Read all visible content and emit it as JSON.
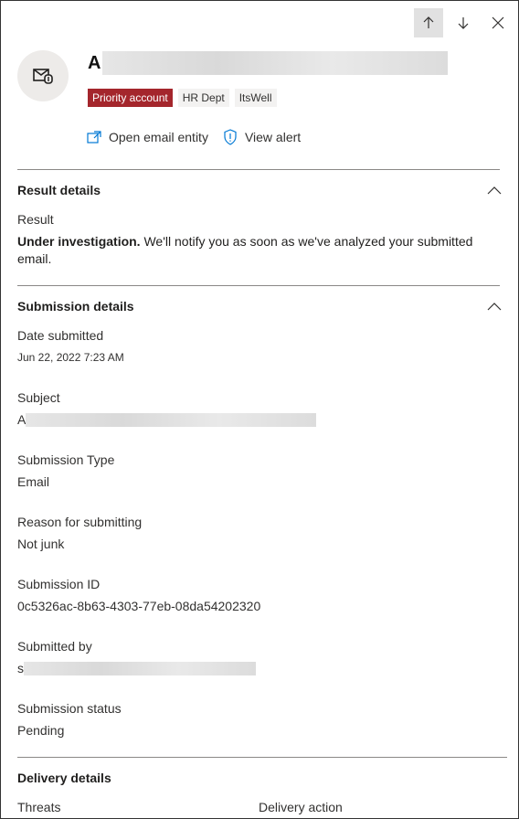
{
  "header": {
    "title_initial": "A",
    "tags": [
      "Priority account",
      "HR Dept",
      "ItsWell"
    ],
    "actions": {
      "open_email_entity": "Open email entity",
      "view_alert": "View alert"
    }
  },
  "result_details": {
    "heading": "Result details",
    "result_label": "Result",
    "result_status": "Under investigation.",
    "result_message": " We'll notify you as soon as we've analyzed your submitted email."
  },
  "submission_details": {
    "heading": "Submission details",
    "date_label": "Date submitted",
    "date_value": "Jun 22, 2022 7:23 AM",
    "subject_label": "Subject",
    "subject_initial": "A",
    "type_label": "Submission Type",
    "type_value": "Email",
    "reason_label": "Reason for submitting",
    "reason_value": "Not junk",
    "id_label": "Submission ID",
    "id_value": "0c5326ac-8b63-4303-77eb-08da54202320",
    "submitted_by_label": "Submitted by",
    "submitted_by_initial": "s",
    "status_label": "Submission status",
    "status_value": "Pending"
  },
  "delivery_details": {
    "heading": "Delivery details",
    "threats_label": "Threats",
    "delivery_action_label": "Delivery action"
  },
  "colors": {
    "priority_tag": "#a4262c",
    "accent": "#0078d4"
  }
}
